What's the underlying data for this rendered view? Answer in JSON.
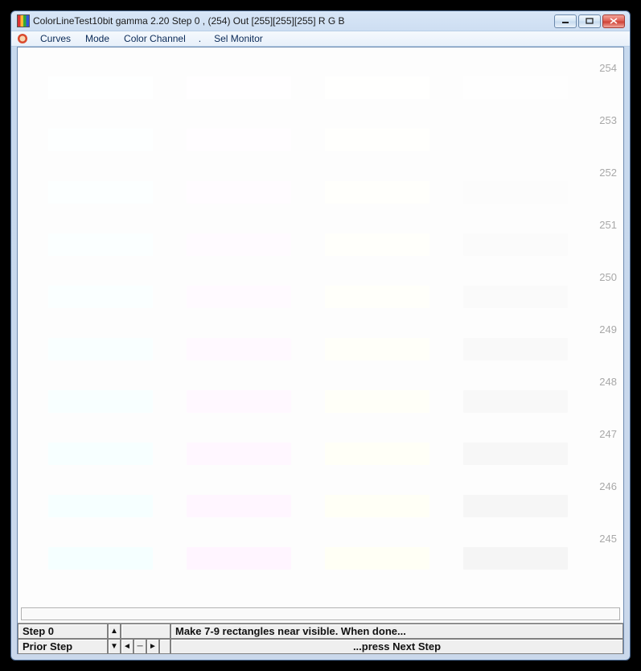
{
  "window": {
    "title": "ColorLineTest10bit gamma 2.20 Step 0 , (254)  Out [255][255][255]   R G B"
  },
  "menu": {
    "curves": "Curves",
    "mode": "Mode",
    "color_channel": "Color Channel",
    "dot": ".",
    "sel_monitor": "Sel Monitor"
  },
  "rows": [
    {
      "label": "254",
      "colors": [
        "#feffff",
        "#fffeff",
        "#fffffe",
        "#fefefe"
      ]
    },
    {
      "label": "253",
      "colors": [
        "#fdffff",
        "#fffdff",
        "#fffffd",
        "#fdfdfd"
      ]
    },
    {
      "label": "252",
      "colors": [
        "#fcffff",
        "#fffcff",
        "#fffffc",
        "#fcfcfc"
      ]
    },
    {
      "label": "251",
      "colors": [
        "#fbffff",
        "#fffbff",
        "#fffffb",
        "#fbfbfb"
      ]
    },
    {
      "label": "250",
      "colors": [
        "#faffff",
        "#fffaff",
        "#fffffa",
        "#fafafa"
      ]
    },
    {
      "label": "249",
      "colors": [
        "#f9ffff",
        "#fff9ff",
        "#fffff9",
        "#f9f9f9"
      ]
    },
    {
      "label": "248",
      "colors": [
        "#f8ffff",
        "#fff8ff",
        "#fffff8",
        "#f8f8f8"
      ]
    },
    {
      "label": "247",
      "colors": [
        "#f7ffff",
        "#fff7ff",
        "#fffff7",
        "#f7f7f7"
      ]
    },
    {
      "label": "246",
      "colors": [
        "#f6ffff",
        "#fff6ff",
        "#fffff6",
        "#f6f6f6"
      ]
    },
    {
      "label": "245",
      "colors": [
        "#f5ffff",
        "#fff5ff",
        "#fffff5",
        "#f5f5f5"
      ]
    }
  ],
  "footer": {
    "step_label": "Step 0",
    "prior_label": "Prior Step",
    "msg1": "Make 7-9 rectangles near visible. When done...",
    "msg2": "...press Next Step"
  }
}
